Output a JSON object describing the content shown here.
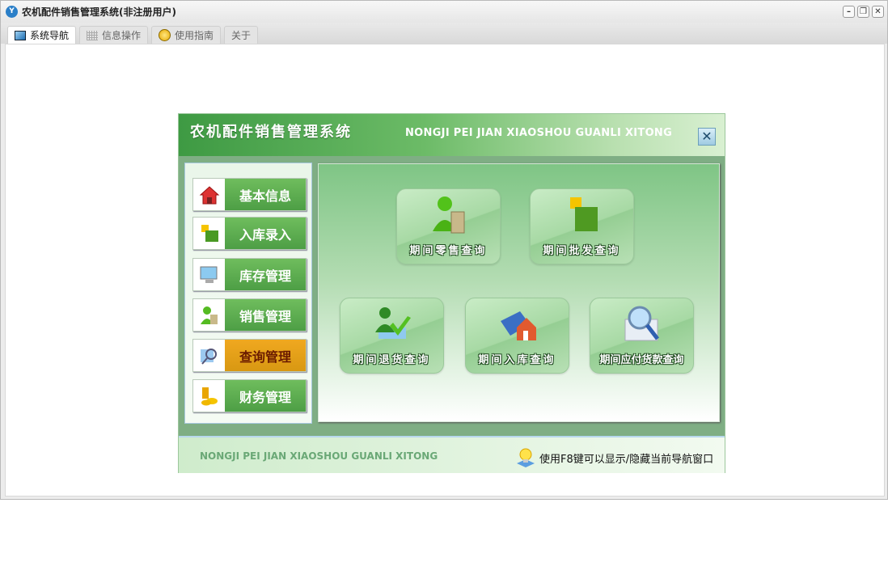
{
  "window": {
    "title": "农机配件销售管理系统(非注册用户)",
    "buttons": [
      "minimize",
      "restore",
      "close"
    ]
  },
  "tabs": [
    {
      "label": "系统导航",
      "icon": "window-icon"
    },
    {
      "label": "信息操作",
      "icon": "grid-icon"
    },
    {
      "label": "使用指南",
      "icon": "help-icon"
    },
    {
      "label": "关于"
    }
  ],
  "dialog": {
    "title_cn": "农机配件销售管理系统",
    "title_en": "NONGJI PEI JIAN XIAOSHOU GUANLI XITONG",
    "nav": [
      {
        "label": "基本信息",
        "icon": "house-icon"
      },
      {
        "label": "入库录入",
        "icon": "box-icon"
      },
      {
        "label": "库存管理",
        "icon": "monitor-icon"
      },
      {
        "label": "销售管理",
        "icon": "user-bag-icon"
      },
      {
        "label": "查询管理",
        "icon": "search-icon",
        "selected": true
      },
      {
        "label": "财务管理",
        "icon": "coins-icon"
      }
    ],
    "tiles": [
      {
        "label": "期间零售查询",
        "icon": "user-bag-icon"
      },
      {
        "label": "期间批发查询",
        "icon": "box-icon"
      },
      {
        "label": "期间退货查询",
        "icon": "user-return-icon"
      },
      {
        "label": "期间入库查询",
        "icon": "book-house-icon"
      },
      {
        "label": "期间应付货款查询",
        "icon": "magnifier-icon"
      }
    ],
    "footer_en": "NONGJI PEI JIAN XIAOSHOU GUANLI XITONG",
    "hint": "使用F8键可以显示/隐藏当前导航窗口"
  }
}
